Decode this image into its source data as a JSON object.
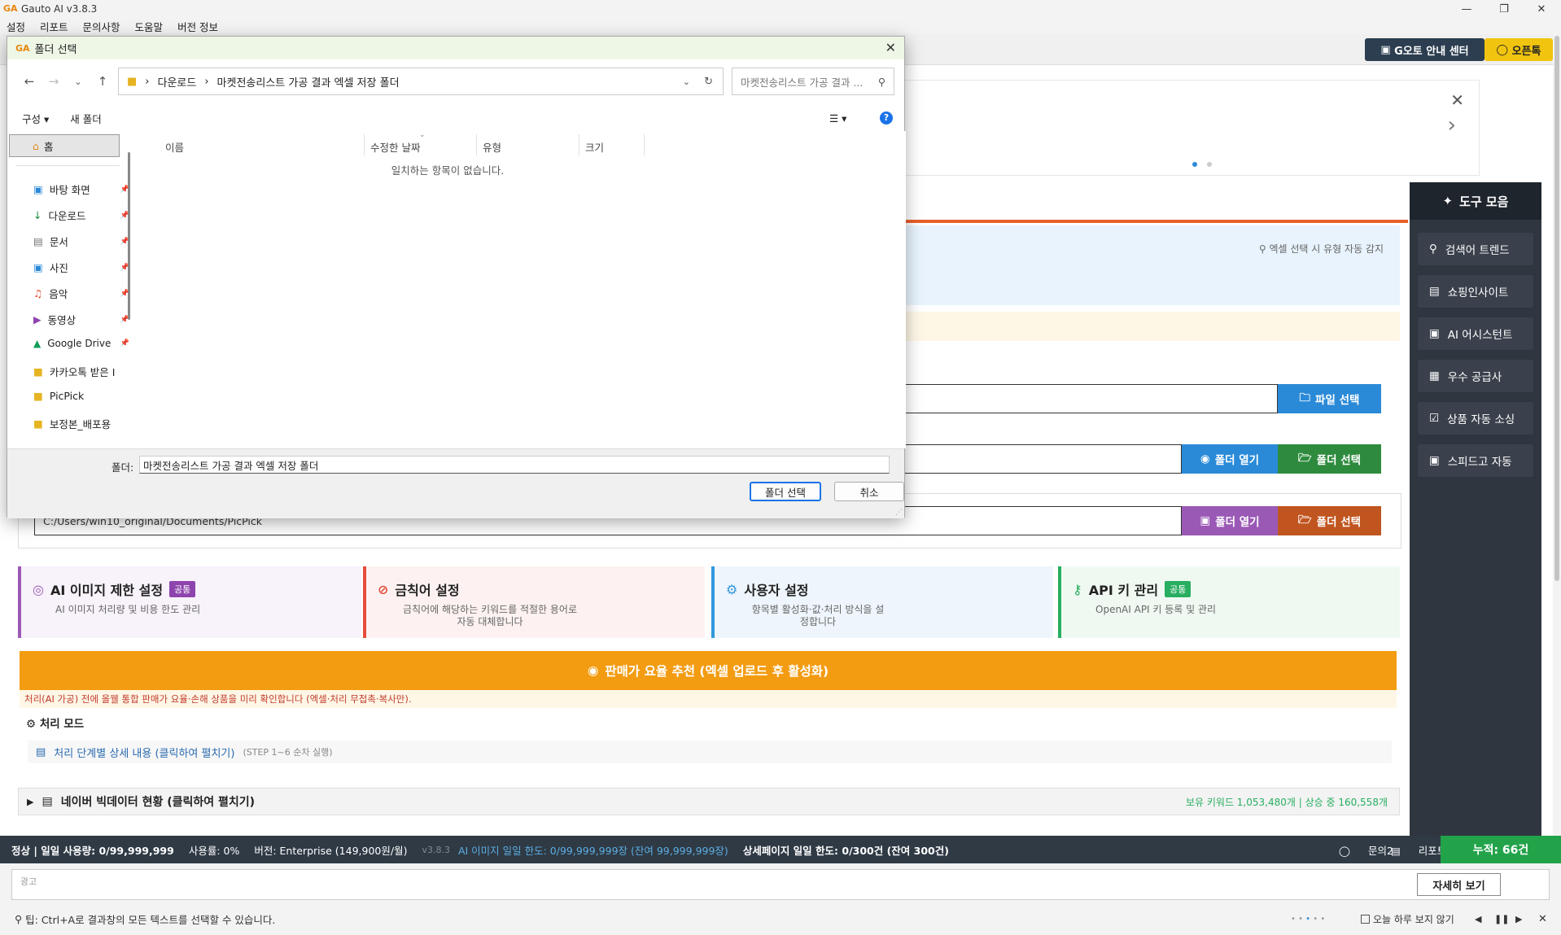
{
  "window": {
    "title": "Gauto AI v3.8.3",
    "menu": [
      "설정",
      "리포트",
      "문의사항",
      "도움말",
      "버전 정보"
    ]
  },
  "header_buttons": {
    "guide": "G오토 안내 센터",
    "openchat": "오픈톡"
  },
  "info_panel": {
    "auto_detect": "엑셀 선택 시 유형 자동 감지"
  },
  "tool_sidebar": {
    "title": "도구 모음",
    "items": [
      "검색어 트렌드",
      "쇼핑인사이트",
      "AI 어시스턴트",
      "우수 공급사",
      "상품 자동 소싱",
      "스피드고 자동"
    ]
  },
  "rows": {
    "file_select": "파일 선택",
    "folder_open": "폴더 열기",
    "folder_select": "폴더 선택",
    "path_value": "C:/Users/win10_original/Documents/PicPick"
  },
  "cards": [
    {
      "title": "AI 이미지 제한 설정",
      "badge": "공통",
      "sub": "AI 이미지 처리량 및 비용 한도 관리"
    },
    {
      "title": "금칙어 설정",
      "sub": "금칙어에 해당하는 키워드를 적절한 용어로 자동 대체합니다"
    },
    {
      "title": "사용자 설정",
      "sub": "항목별 활성화·값·처리 방식을 설정합니다"
    },
    {
      "title": "API 키 관리",
      "badge": "공통",
      "sub": "OpenAI API 키 등록 및 관리"
    }
  ],
  "fee_button": "판매가 요율 추천 (엑셀 업로드 후 활성화)",
  "warning": "처리(AI 가공) 전에 올웰 통합 판매가 요율·손해 상품을 미리 확인합니다 (엑셀·처리 무접촉·복사만).",
  "processing_mode": {
    "title": "처리 모드",
    "step_link": "처리 단계별 상세 내용 (클릭하여 펼치기)",
    "step_note": "(STEP 1~6 순차 실행)"
  },
  "naver": {
    "title": "네이버 빅데이터 현황 (클릭하여 펼치기)",
    "stats": "보유 키워드 1,053,480개 | 상승 중 160,558개"
  },
  "status_bar": {
    "usage": "정상 | 일일 사용량: 0/99,999,999",
    "rate": "사용률: 0%",
    "version": "버전: Enterprise (149,900원/월)",
    "ver_num": "v3.8.3",
    "ai_limit": "AI 이미지 일일 한도: 0/99,999,999장 (잔여 99,999,999장)",
    "detail_limit": "상세페이지 일일 한도: 0/300건 (잔여 300건)",
    "inquiry": "문의2",
    "report": "리포트",
    "cumulative": "누적: 66건"
  },
  "ad": {
    "label": "광고",
    "detail_button": "자세히 보기"
  },
  "tip": {
    "text": "팁: Ctrl+A로 결과창의 모든 텍스트를 선택할 수 있습니다.",
    "hide_today": "오늘 하루 보지 않기"
  },
  "dialog": {
    "title": "폴더 선택",
    "breadcrumb": [
      "다운로드",
      "마켓전송리스트 가공 결과 엑셀 저장 폴더"
    ],
    "search_placeholder": "마켓전송리스트 가공 결과 ...",
    "organize": "구성",
    "new_folder": "새 폴더",
    "home": "홈",
    "nav_items": [
      "바탕 화면",
      "다운로드",
      "문서",
      "사진",
      "음악",
      "동영상",
      "Google Drive",
      "카카오톡 받은 I",
      "PicPick",
      "보정본_배포용"
    ],
    "columns": [
      "이름",
      "수정한 날짜",
      "유형",
      "크기"
    ],
    "empty": "일치하는 항목이 없습니다.",
    "folder_label": "폴더:",
    "folder_value": "마켓전송리스트 가공 결과 엑셀 저장 폴더",
    "ok": "폴더 선택",
    "cancel": "취소"
  },
  "colors": {
    "accent_blue": "#2a8ad8",
    "green": "#2e8b3e",
    "purple": "#9b59b6",
    "rust": "#c0551f",
    "orange": "#f39c12",
    "sidebar": "#2f3640"
  }
}
